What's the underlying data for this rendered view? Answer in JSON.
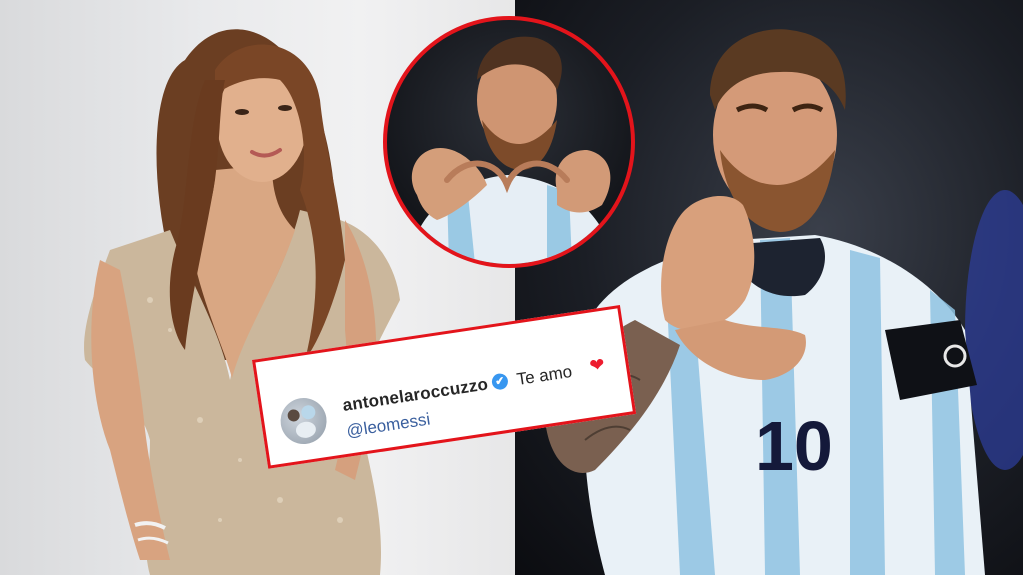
{
  "comment": {
    "username": "antonelaroccuzzo",
    "verified_mark": "✔",
    "text": "Te amo",
    "heart": "❤",
    "mention": "@leomessi"
  },
  "jersey": {
    "number": "10"
  },
  "colors": {
    "border_red": "#e3141b",
    "verified_blue": "#3897f0",
    "mention_blue": "#3a5f9e",
    "heart_red": "#ed1c2e"
  },
  "icons": [
    "verified-badge-icon",
    "heart-icon"
  ]
}
